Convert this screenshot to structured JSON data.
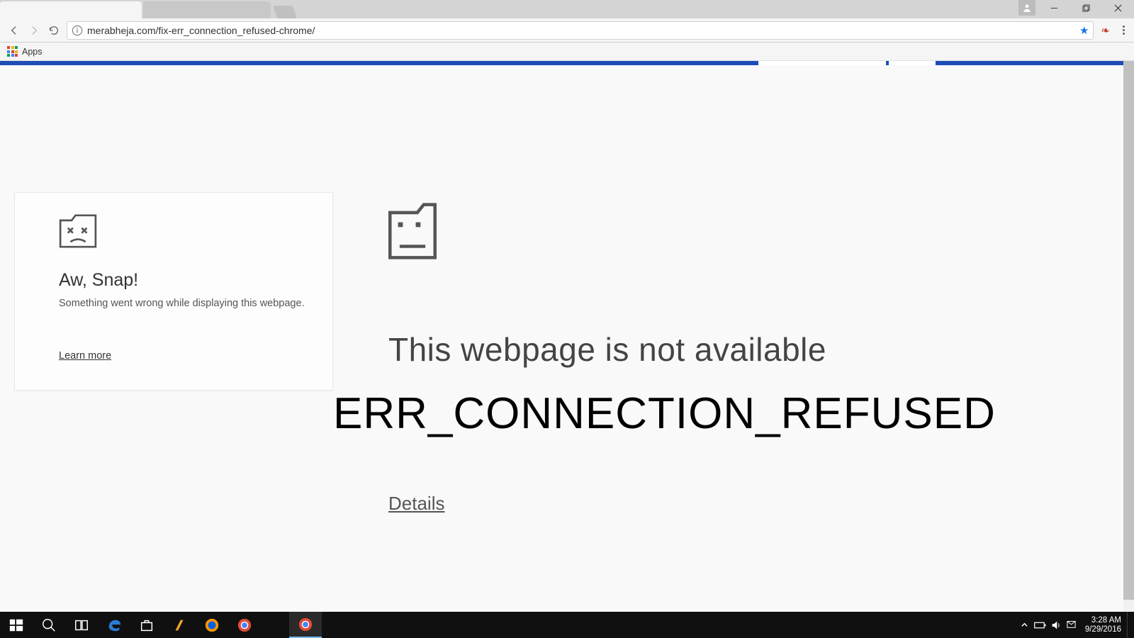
{
  "browser": {
    "url_host": "merabheja.com",
    "url_path": "/fix-err_connection_refused-chrome/"
  },
  "bookmarks": {
    "apps_label": "Apps"
  },
  "card": {
    "title": "Aw, Snap!",
    "message": "Something went wrong while displaying this webpage.",
    "learn_more": "Learn more"
  },
  "main_error": {
    "heading": "This webpage is not available",
    "code": "ERR_CONNECTION_REFUSED",
    "details": "Details"
  },
  "taskbar": {
    "time": "3:28 AM",
    "date": "9/29/2016"
  }
}
